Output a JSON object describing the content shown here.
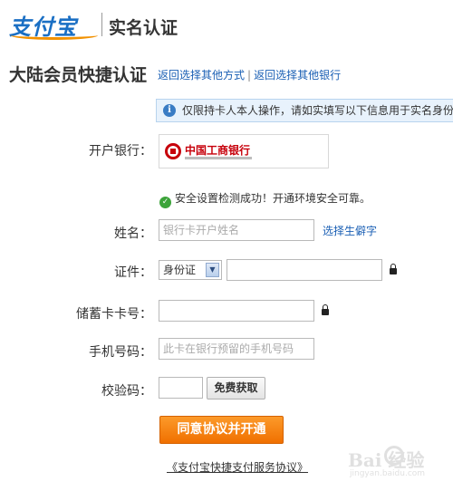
{
  "header": {
    "logo_text": "支付宝",
    "title": "实名认证"
  },
  "section": {
    "title": "大陆会员快捷认证",
    "link_other_method": "返回选择其他方式",
    "link_separator": "|",
    "link_other_bank": "返回选择其他银行"
  },
  "info_bar": {
    "icon": "info-icon",
    "text": "仅限持卡人本人操作，请如实填写以下信息用于实名身份验"
  },
  "form": {
    "bank_label": "开户银行：",
    "bank_name": "中国工商银行",
    "security_message": "安全设置检测成功！开通环境安全可靠。",
    "name_label": "姓名：",
    "name_placeholder": "银行卡开户姓名",
    "name_value": "",
    "rare_char_link": "选择生僻字",
    "id_label": "证件：",
    "id_type_selected": "身份证",
    "id_value": "",
    "card_label": "储蓄卡卡号：",
    "card_value": "",
    "phone_label": "手机号码：",
    "phone_placeholder": "此卡在银行预留的手机号码",
    "phone_value": "",
    "captcha_label": "校验码：",
    "captcha_value": "",
    "captcha_button": "免费获取",
    "submit_button": "同意协议并开通",
    "agreement_link": "《支付宝快捷支付服务协议》"
  },
  "watermark": {
    "text": "Bai 经验",
    "sub": "jingyan.baidu.com"
  },
  "colors": {
    "brand_blue": "#1a6fc4",
    "link_blue": "#1a5fb4",
    "submit_orange": "#f07000",
    "bank_red": "#c7000b",
    "success_green": "#3ca33a",
    "info_bg": "#e8f2fc"
  }
}
